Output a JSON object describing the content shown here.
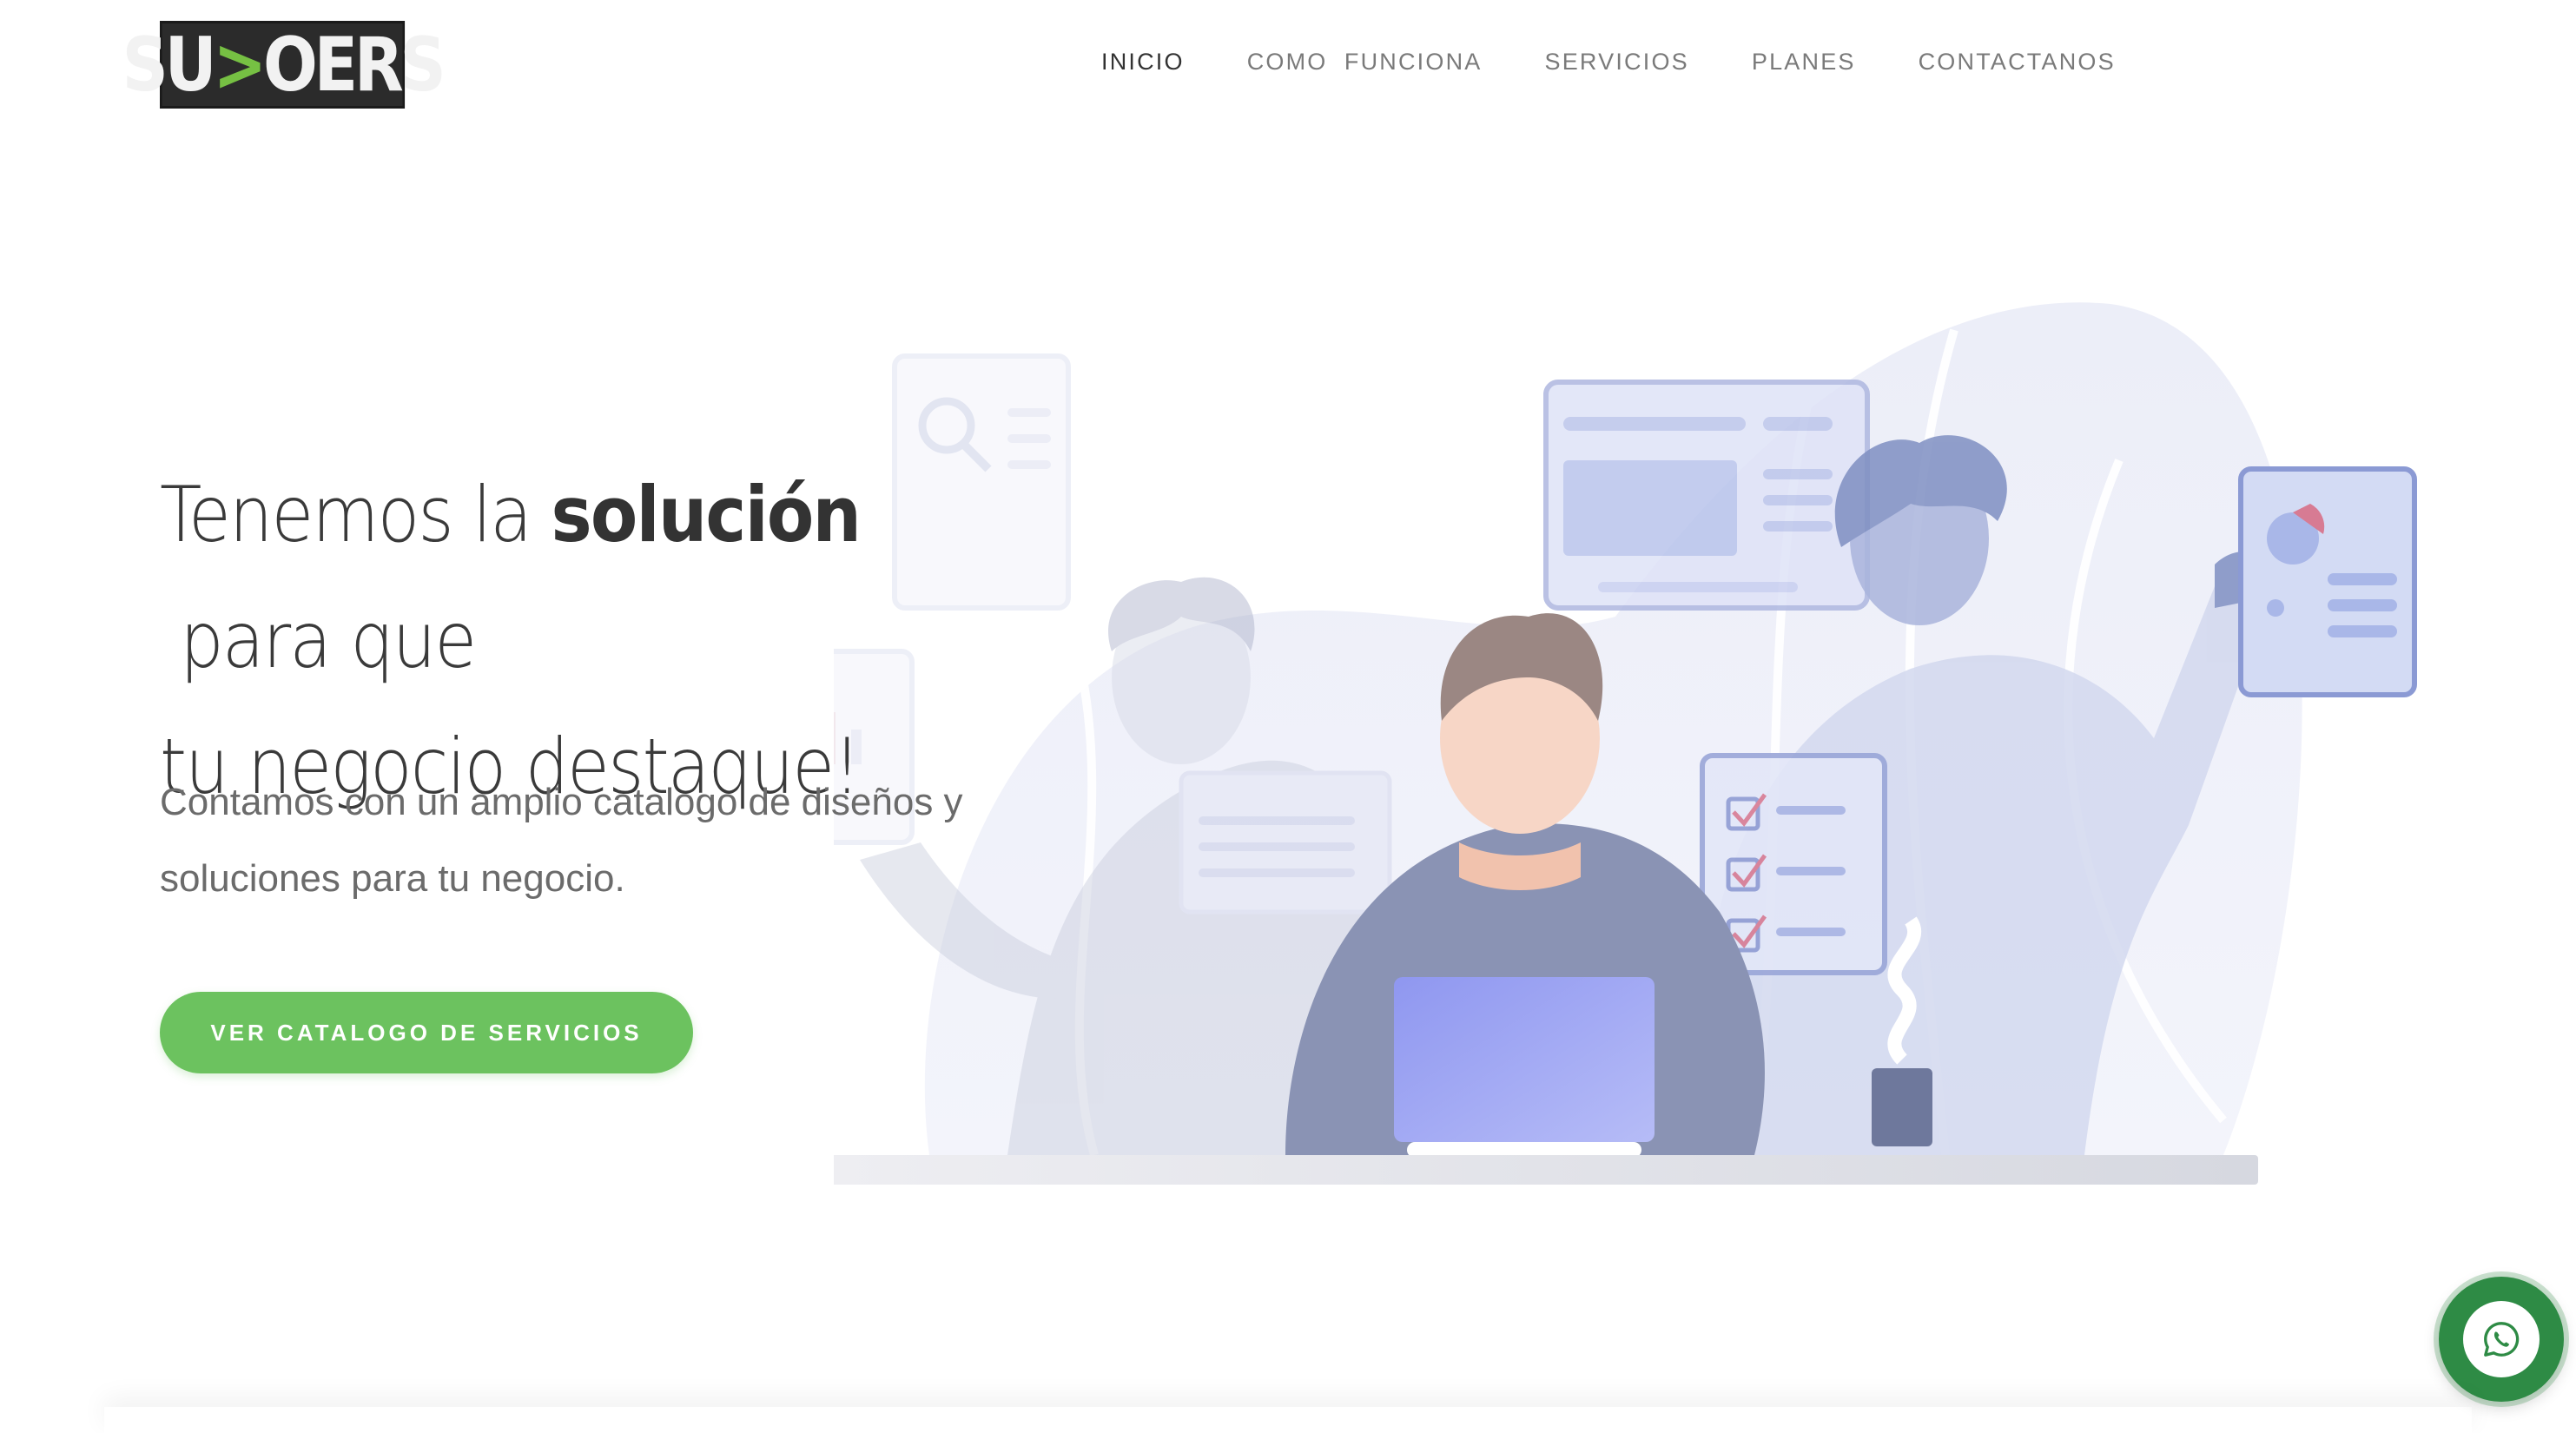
{
  "brand": {
    "logo_left": "SU",
    "logo_arrow": ">",
    "logo_right": "OERS"
  },
  "nav": {
    "items": [
      {
        "label": "INICIO",
        "active": true
      },
      {
        "label": "COMO  FUNCIONA",
        "active": false
      },
      {
        "label": "SERVICIOS",
        "active": false
      },
      {
        "label": "PLANES",
        "active": false
      },
      {
        "label": "CONTACTANOS",
        "active": false
      }
    ]
  },
  "hero": {
    "headline_pre": "Tenemos la ",
    "headline_bold": "solución",
    "headline_post": " para que",
    "headline_line2": "tu negocio destaque!",
    "subtext_line1": "Contamos con un amplio catalogo de diseños y",
    "subtext_line2": "soluciones para tu negocio.",
    "cta_label": "VER CATALOGO DE SERVICIOS"
  },
  "floating": {
    "whatsapp_icon": "whatsapp-icon"
  },
  "colors": {
    "accent": "#6cc25f",
    "logo_bg": "#2b2b2b",
    "logo_arrow": "#76c043",
    "whatsapp": "#2e8b45"
  }
}
